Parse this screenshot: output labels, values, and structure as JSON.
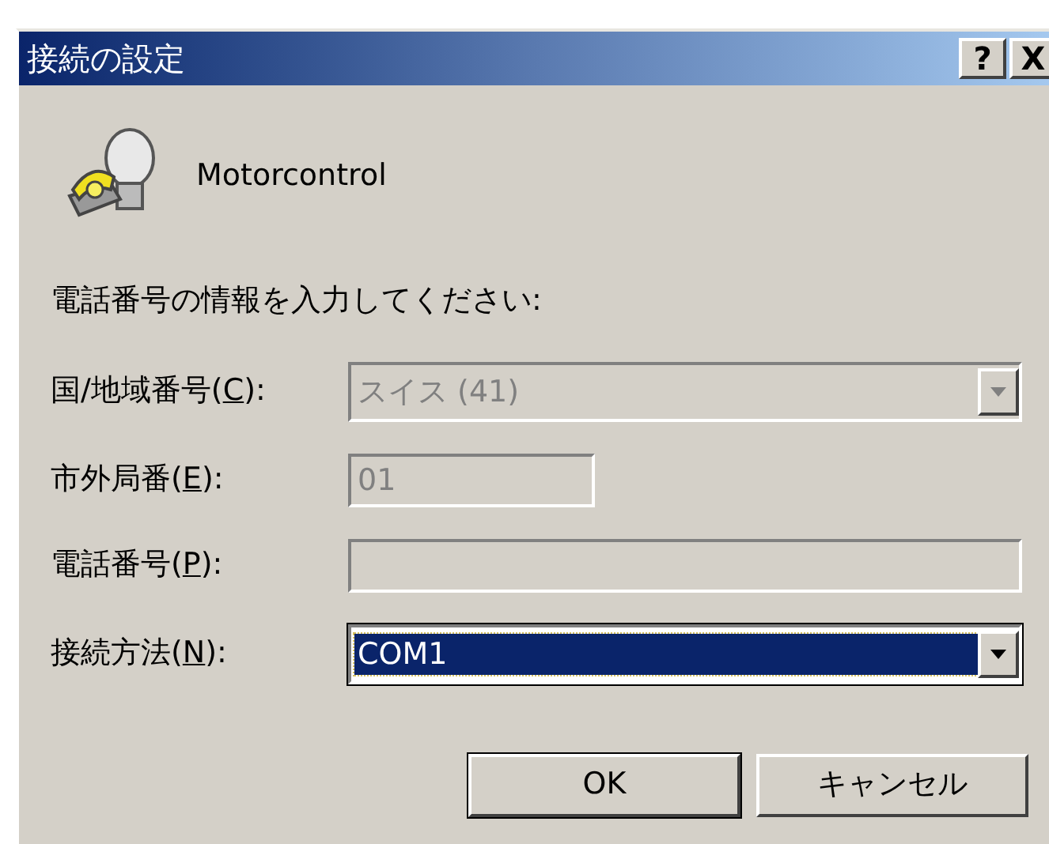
{
  "window": {
    "title": "接続の設定",
    "title_buttons": [
      "?",
      "X"
    ]
  },
  "connection": {
    "name": "Motorcontrol"
  },
  "prompt": "電話番号の情報を入力してください:",
  "fields": [
    {
      "kind": "combo",
      "label_before": "国/地域番号(",
      "mnemonic": "C",
      "label_after": "):",
      "value": "スイス (41)",
      "disabled": true,
      "selected": false
    },
    {
      "kind": "short",
      "label_before": "市外局番(",
      "mnemonic": "E",
      "label_after": "):",
      "value": "01",
      "disabled": true,
      "selected": false
    },
    {
      "kind": "text",
      "label_before": "電話番号(",
      "mnemonic": "P",
      "label_after": "):",
      "disabled": true,
      "selected": false
    },
    {
      "kind": "combo",
      "label_before": "接続方法(",
      "mnemonic": "N",
      "label_after": "):",
      "value": "COM1",
      "disabled": false,
      "selected": true
    }
  ],
  "buttons": [
    {
      "label": "OK",
      "default": true
    },
    {
      "label": "キャンセル",
      "default": false
    }
  ]
}
